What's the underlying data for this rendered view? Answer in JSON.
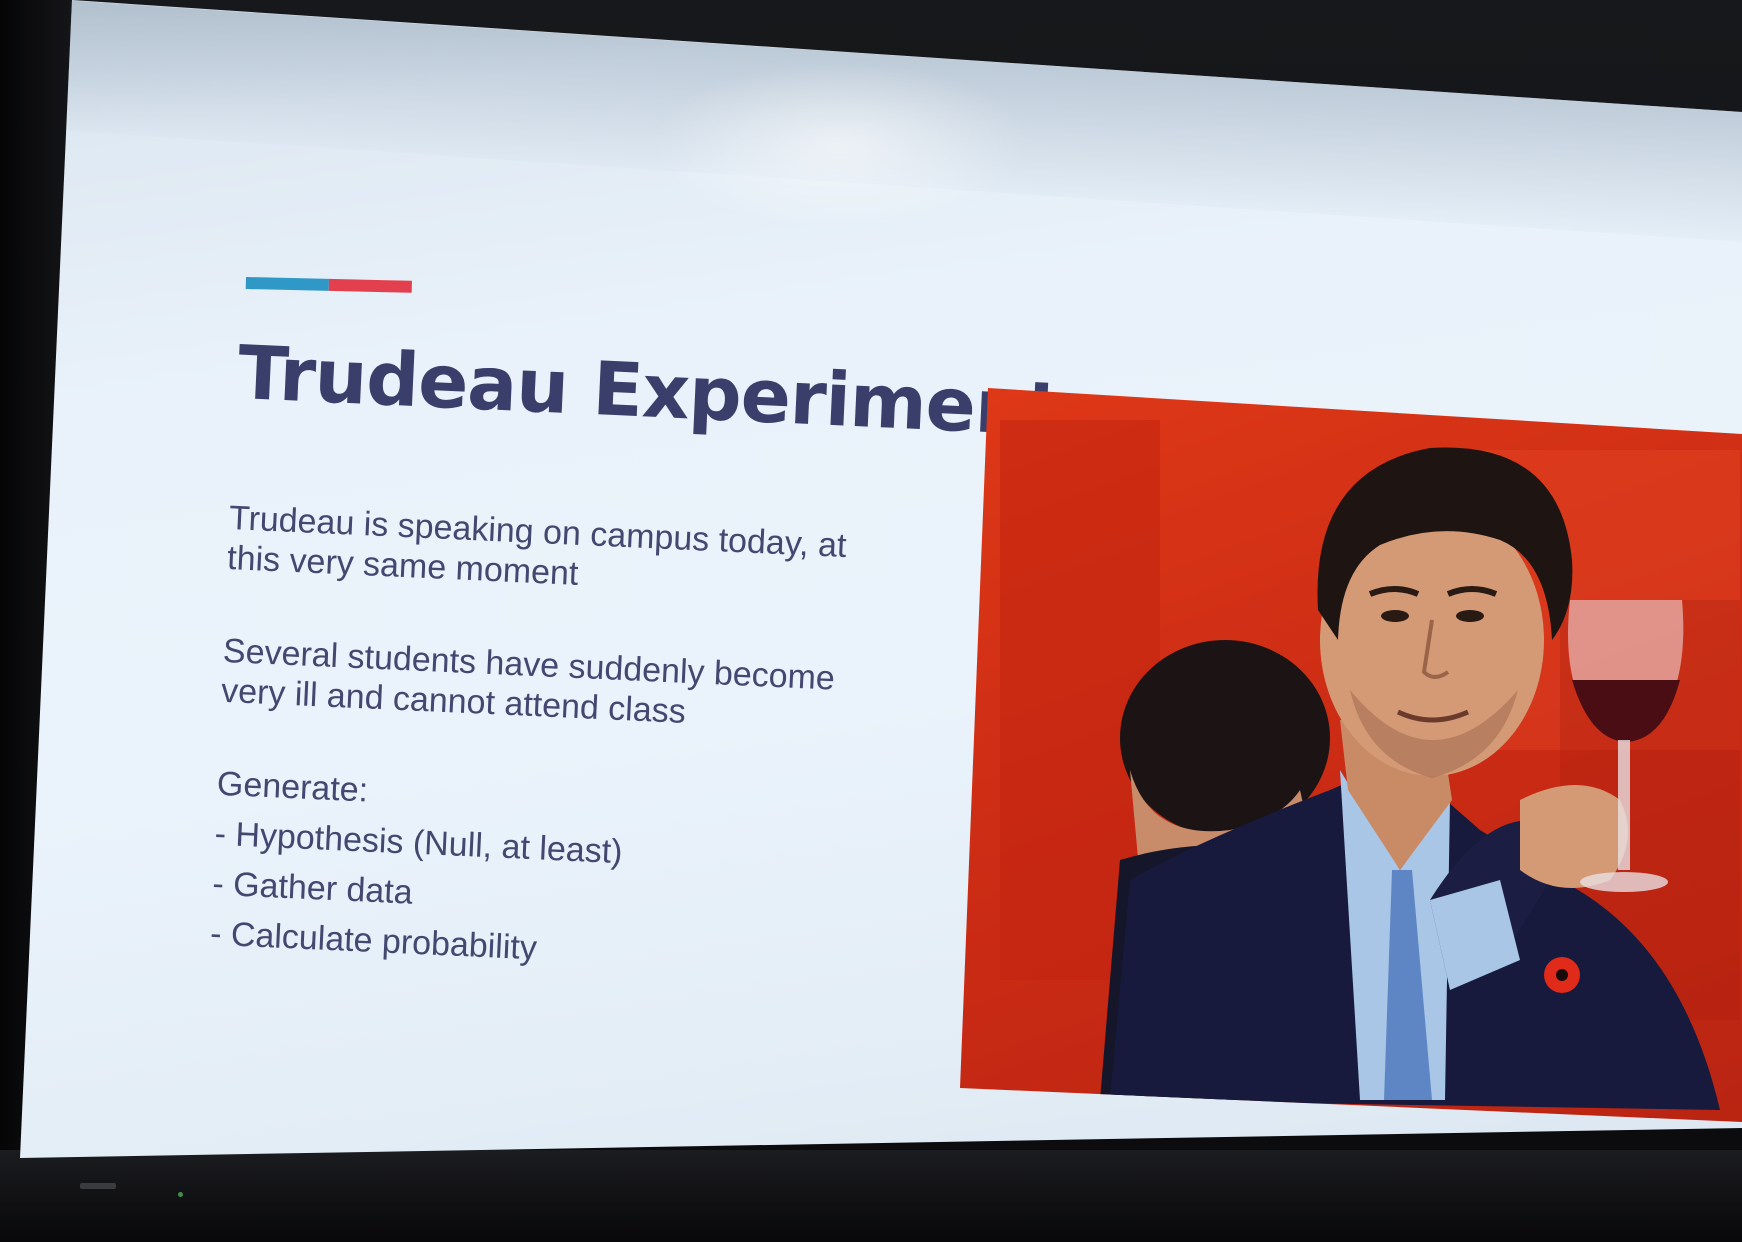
{
  "slide": {
    "title": "Trudeau Experiment",
    "paragraph_1": "Trudeau is speaking on campus today, at this very same moment",
    "paragraph_2": "Several students have suddenly become very ill and cannot attend class",
    "list_heading": "Generate:",
    "items": [
      "- Hypothesis (Null, at least)",
      "- Gather data",
      "- Calculate probability"
    ]
  },
  "colors": {
    "accent_blue": "#2f98c6",
    "accent_red": "#e2404e",
    "title_text": "#3a3e6a",
    "body_text": "#434870",
    "photo_background": "#d63318"
  },
  "photo": {
    "icon": "photo-of-man-raising-wine-glass"
  }
}
